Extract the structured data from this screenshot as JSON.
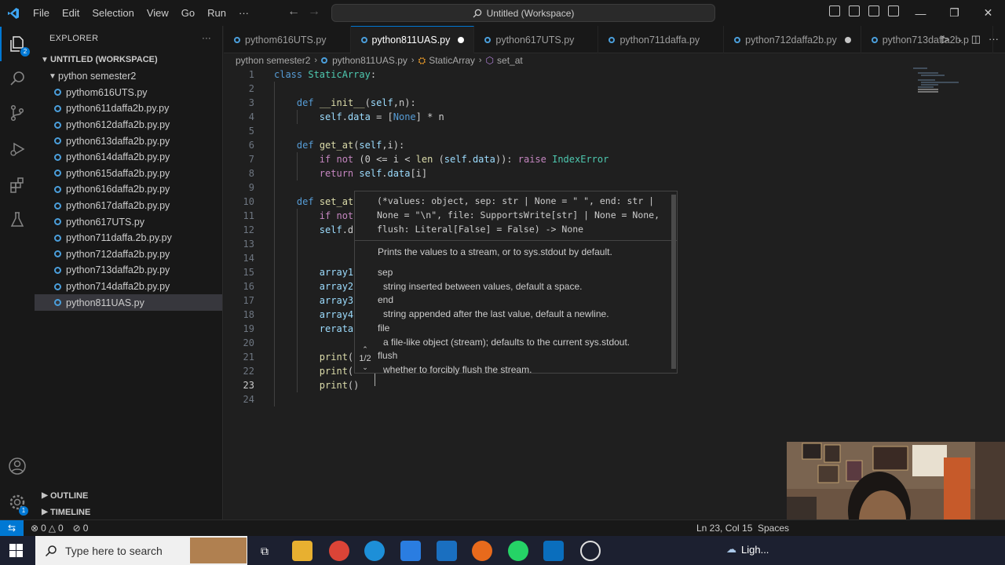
{
  "titlebar": {
    "menus": [
      "File",
      "Edit",
      "Selection",
      "View",
      "Go",
      "Run",
      "···"
    ],
    "command_center": "Untitled (Workspace)"
  },
  "sidebar": {
    "title": "EXPLORER",
    "more": "···",
    "workspace": "UNTITLED (WORKSPACE)",
    "folder": "python semester2",
    "files": [
      "pythom616UTS.py",
      "python611daffa2b.py.py",
      "python612daffa2b.py.py",
      "python613daffa2b.py.py",
      "python614daffa2b.py.py",
      "python615daffa2b.py.py",
      "python616daffa2b.py.py",
      "python617daffa2b.py.py",
      "python617UTS.py",
      "python711daffa.2b.py.py",
      "python712daffa2b.py.py",
      "python713daffa2b.py.py",
      "python714daffa2b.py.py",
      "python811UAS.py"
    ],
    "selected_index": 13,
    "outline": "OUTLINE",
    "timeline": "TIMELINE"
  },
  "tabs": [
    {
      "label": "pythom616UTS.py",
      "active": false,
      "modified": false
    },
    {
      "label": "python811UAS.py",
      "active": true,
      "modified": true
    },
    {
      "label": "python617UTS.py",
      "active": false,
      "modified": false
    },
    {
      "label": "python711daffa.py",
      "active": false,
      "modified": false
    },
    {
      "label": "python712daffa2b.py",
      "active": false,
      "modified": true
    },
    {
      "label": "python713daffa2b.p",
      "active": false,
      "modified": false
    }
  ],
  "breadcrumb": [
    "python semester2",
    "python811UAS.py",
    "StaticArray",
    "set_at"
  ],
  "editor": {
    "current_line": 23,
    "lines": [
      {
        "n": "1",
        "text": "class StaticArray:"
      },
      {
        "n": "2",
        "text": ""
      },
      {
        "n": "3",
        "text": "    def __init__(self,n):"
      },
      {
        "n": "4",
        "text": "        self.data = [None] * n"
      },
      {
        "n": "5",
        "text": ""
      },
      {
        "n": "6",
        "text": "    def get_at(self,i):"
      },
      {
        "n": "7",
        "text": "        if not (0 <= i < len (self.data)): raise IndexError"
      },
      {
        "n": "8",
        "text": "        return self.data[i]"
      },
      {
        "n": "9",
        "text": ""
      },
      {
        "n": "10",
        "text": "    def set_at"
      },
      {
        "n": "11",
        "text": "        if not"
      },
      {
        "n": "12",
        "text": "        self.d"
      },
      {
        "n": "13",
        "text": ""
      },
      {
        "n": "14",
        "text": ""
      },
      {
        "n": "15",
        "text": "        array1"
      },
      {
        "n": "16",
        "text": "        array2"
      },
      {
        "n": "17",
        "text": "        array3"
      },
      {
        "n": "18",
        "text": "        array4"
      },
      {
        "n": "19",
        "text": "        rerata"
      },
      {
        "n": "20",
        "text": ""
      },
      {
        "n": "21",
        "text": "        print("
      },
      {
        "n": "22",
        "text": "        print("
      },
      {
        "n": "23",
        "text": "        print()"
      },
      {
        "n": "24",
        "text": ""
      }
    ]
  },
  "hover": {
    "signature": "(*values: object, sep: str | None = \" \", end: str | None = \"\\n\", file: SupportsWrite[str] | None = None, flush: Literal[False] = False) -> None",
    "description": "Prints the values to a stream, or to sys.stdout by default.",
    "params": [
      {
        "name": "sep",
        "desc": "string inserted between values, default a space."
      },
      {
        "name": "end",
        "desc": "string appended after the last value, default a newline."
      },
      {
        "name": "file",
        "desc": "a file-like object (stream); defaults to the current sys.stdout."
      },
      {
        "name": "flush",
        "desc": "whether to forcibly flush the stream."
      }
    ],
    "pager": "1/2"
  },
  "statusbar": {
    "errors": "0",
    "warnings": "0",
    "ports": "0",
    "position": "Ln 23, Col 15",
    "spaces": "Spaces"
  },
  "taskbar": {
    "search_placeholder": "Type here to search",
    "weather": "Ligh..."
  },
  "colors": {
    "accent": "#0078d4",
    "keyword": "#569cd6",
    "class": "#4ec9b0",
    "function": "#dcdcaa",
    "variable": "#9cdcfe"
  }
}
